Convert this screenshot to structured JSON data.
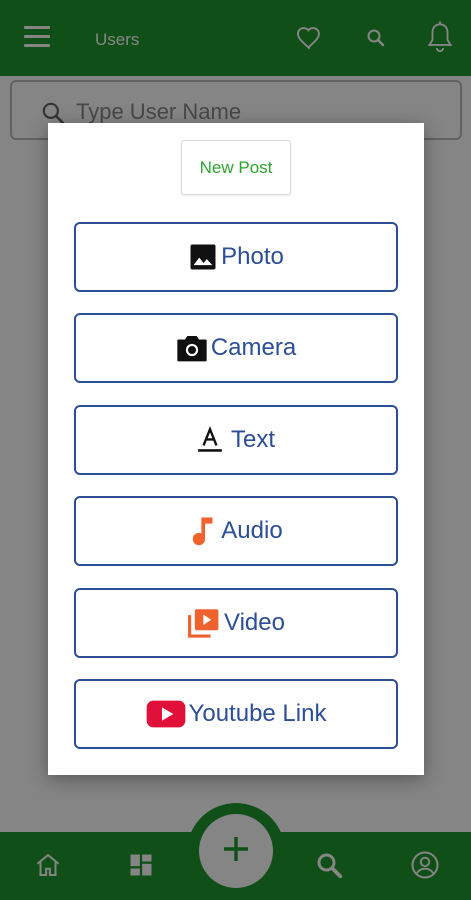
{
  "header": {
    "title": "Users",
    "icons": [
      "menu-icon",
      "heart-icon",
      "search-icon",
      "bell-icon"
    ]
  },
  "search": {
    "placeholder": "Type User Name",
    "value": ""
  },
  "dialog": {
    "title": "New Post",
    "options": [
      {
        "label": "Photo",
        "icon": "photo-icon"
      },
      {
        "label": "Camera",
        "icon": "camera-icon"
      },
      {
        "label": "Text",
        "icon": "text-format-icon"
      },
      {
        "label": "Audio",
        "icon": "music-note-icon"
      },
      {
        "label": "Video",
        "icon": "video-library-icon"
      },
      {
        "label": "Youtube Link",
        "icon": "youtube-icon"
      }
    ]
  },
  "bottom_nav": {
    "items": [
      "home-icon",
      "dashboard-icon",
      "add-icon",
      "search-icon",
      "profile-icon"
    ]
  },
  "colors": {
    "brand_green": "#1f9a2e",
    "option_border": "#2c4e96",
    "title_green": "#2ea52f",
    "accent_orange": "#f0622d",
    "youtube_red": "#e0103a"
  }
}
